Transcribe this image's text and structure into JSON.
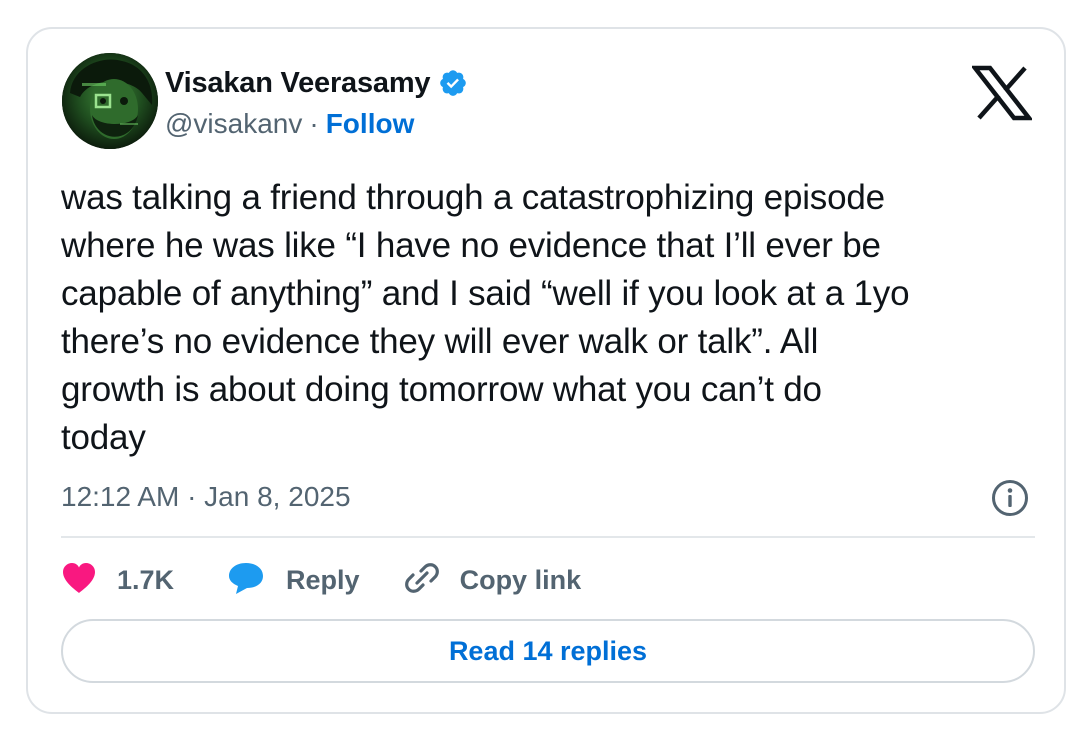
{
  "author": {
    "name": "Visakan Veerasamy",
    "handle": "@visakanv",
    "separator": "·",
    "follow_label": "Follow",
    "verified": true
  },
  "tweet": {
    "text": "was talking a friend through a catastrophizing episode\nwhere he was like “I have no evidence that I’ll ever be\ncapable of anything” and I said “well if you look at a 1yo\nthere’s no evidence they will ever walk or talk”. All\ngrowth is about doing tomorrow what you can’t do\ntoday",
    "timestamp": "12:12 AM · Jan 8, 2025"
  },
  "actions": {
    "like_count": "1.7K",
    "reply_label": "Reply",
    "copy_link_label": "Copy link"
  },
  "read_replies_label": "Read 14 replies",
  "icons": {
    "logo": "x-logo-icon",
    "verified": "verified-badge-icon",
    "info": "info-icon",
    "like": "heart-icon",
    "reply": "speech-bubble-icon",
    "copy": "link-icon"
  },
  "colors": {
    "accent_blue": "#006fd6",
    "verified_blue": "#1d9bf0",
    "like_pink": "#f91880",
    "text_primary": "#0f1419",
    "text_secondary": "#536471",
    "border": "#dfe3e7"
  }
}
